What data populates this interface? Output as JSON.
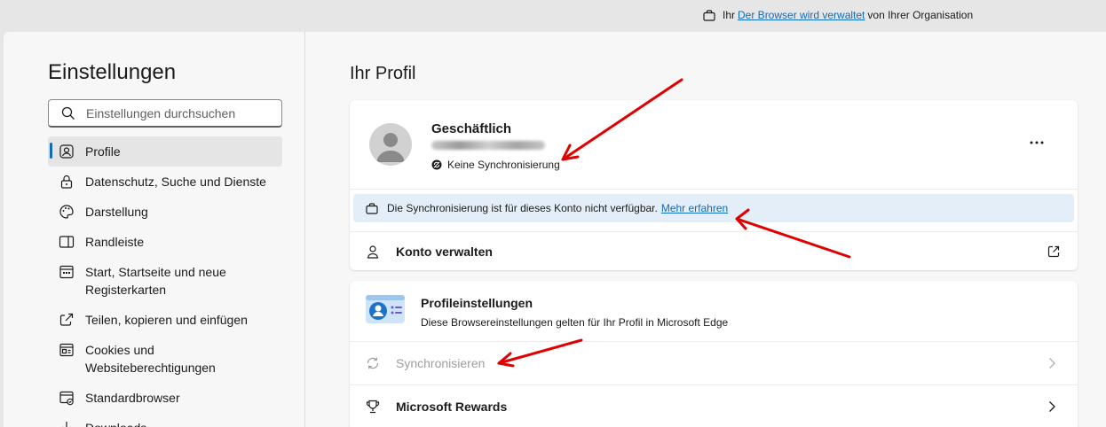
{
  "banner": {
    "prefix": "Ihr",
    "link": "Der Browser wird verwaltet",
    "suffix": "von Ihrer Organisation"
  },
  "sidebar": {
    "title": "Einstellungen",
    "search_placeholder": "Einstellungen durchsuchen",
    "items": [
      {
        "label": "Profile",
        "icon": "profile-icon",
        "active": true
      },
      {
        "label": "Datenschutz, Suche und Dienste",
        "icon": "lock-icon"
      },
      {
        "label": "Darstellung",
        "icon": "palette-icon"
      },
      {
        "label": "Randleiste",
        "icon": "sidebar-icon"
      },
      {
        "label": "Start, Startseite und neue Registerkarten",
        "icon": "start-page-icon"
      },
      {
        "label": "Teilen, kopieren und einfügen",
        "icon": "share-icon"
      },
      {
        "label": "Cookies und Websiteberechtigungen",
        "icon": "cookies-icon"
      },
      {
        "label": "Standardbrowser",
        "icon": "default-browser-icon"
      },
      {
        "label": "Downloads",
        "icon": "download-icon"
      }
    ]
  },
  "main": {
    "title": "Ihr Profil",
    "profile": {
      "name": "Geschäftlich",
      "sync_status": "Keine Synchronisierung"
    },
    "info": {
      "text": "Die Synchronisierung ist für dieses Konto nicht verfügbar.",
      "link": "Mehr erfahren"
    },
    "manage_account": "Konto verwalten",
    "settings": {
      "title": "Profileinstellungen",
      "description": "Diese Browsereinstellungen gelten für Ihr Profil in Microsoft Edge"
    },
    "sync_row": "Synchronisieren",
    "rewards_row": "Microsoft Rewards"
  },
  "colors": {
    "accent": "#0f6cbd",
    "annotation_arrow": "#e00000",
    "info_bg": "#e3eef9"
  }
}
